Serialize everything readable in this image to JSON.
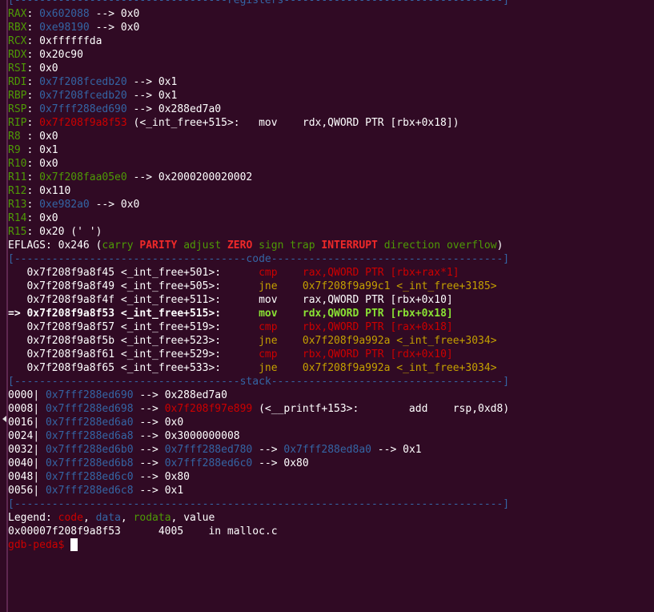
{
  "registers_header": "[----------------------------------registers-----------------------------------]",
  "registers": [
    {
      "name": "RAX",
      "addr": "0x602088",
      "deref": " --> 0x0",
      "addr_color": "blue"
    },
    {
      "name": "RBX",
      "addr": "0xe98190",
      "deref": " --> 0x0",
      "addr_color": "blue"
    },
    {
      "name": "RCX",
      "addr": "0xffffffda",
      "deref": "",
      "addr_color": "white"
    },
    {
      "name": "RDX",
      "addr": "0x20c90",
      "deref": "",
      "addr_color": "white"
    },
    {
      "name": "RSI",
      "addr": "0x0",
      "deref": "",
      "addr_color": "white"
    },
    {
      "name": "RDI",
      "addr": "0x7f208fcedb20",
      "deref": " --> 0x1",
      "addr_color": "blue"
    },
    {
      "name": "RBP",
      "addr": "0x7f208fcedb20",
      "deref": " --> 0x1",
      "addr_color": "blue"
    },
    {
      "name": "RSP",
      "addr": "0x7fff288ed690",
      "deref": " --> 0x288ed7a0",
      "addr_color": "blue"
    },
    {
      "name": "RIP",
      "addr": "0x7f208f9a8f53",
      "deref": " (<_int_free+515>:   mov    rdx,QWORD PTR [rbx+0x18])",
      "addr_color": "red"
    },
    {
      "name": "R8 ",
      "addr": "0x0",
      "deref": "",
      "addr_color": "white"
    },
    {
      "name": "R9 ",
      "addr": "0x1",
      "deref": "",
      "addr_color": "white"
    },
    {
      "name": "R10",
      "addr": "0x0",
      "deref": "",
      "addr_color": "white"
    },
    {
      "name": "R11",
      "addr": "0x7f208faa05e0",
      "deref": " --> 0x2000200020002",
      "addr_color": "green"
    },
    {
      "name": "R12",
      "addr": "0x110",
      "deref": "",
      "addr_color": "white"
    },
    {
      "name": "R13",
      "addr": "0xe982a0",
      "deref": " --> 0x0",
      "addr_color": "blue"
    },
    {
      "name": "R14",
      "addr": "0x0",
      "deref": "",
      "addr_color": "white"
    },
    {
      "name": "R15",
      "addr": "0x20 (' ')",
      "deref": "",
      "addr_color": "white"
    }
  ],
  "eflags": {
    "label": "EFLAGS",
    "value": "0x246",
    "flags": [
      {
        "text": "carry",
        "on": false
      },
      {
        "text": "PARITY",
        "on": true
      },
      {
        "text": "adjust",
        "on": false
      },
      {
        "text": "ZERO",
        "on": true
      },
      {
        "text": "sign",
        "on": false
      },
      {
        "text": "trap",
        "on": false
      },
      {
        "text": "INTERRUPT",
        "on": true
      },
      {
        "text": "direction",
        "on": false
      },
      {
        "text": "overflow",
        "on": false
      }
    ]
  },
  "code_header": "[-------------------------------------code-------------------------------------]",
  "code": [
    {
      "prefix": "   ",
      "addr": "0x7f208f9a8f45",
      "sym": "<_int_free+501>:",
      "mnem": "cmp",
      "ops": "rax,QWORD PTR [rbx+rax*1]",
      "color": "red",
      "current": false
    },
    {
      "prefix": "   ",
      "addr": "0x7f208f9a8f49",
      "sym": "<_int_free+505>:",
      "mnem": "jne",
      "ops": "0x7f208f9a99c1 <_int_free+3185>",
      "color": "yellow",
      "current": false
    },
    {
      "prefix": "   ",
      "addr": "0x7f208f9a8f4f",
      "sym": "<_int_free+511>:",
      "mnem": "mov",
      "ops": "rax,QWORD PTR [rbx+0x10]",
      "color": "white",
      "current": false
    },
    {
      "prefix": "=> ",
      "addr": "0x7f208f9a8f53",
      "sym": "<_int_free+515>:",
      "mnem": "mov",
      "ops": "rdx,QWORD PTR [rbx+0x18]",
      "color": "bgreen",
      "current": true
    },
    {
      "prefix": "   ",
      "addr": "0x7f208f9a8f57",
      "sym": "<_int_free+519>:",
      "mnem": "cmp",
      "ops": "rbx,QWORD PTR [rax+0x18]",
      "color": "red",
      "current": false
    },
    {
      "prefix": "   ",
      "addr": "0x7f208f9a8f5b",
      "sym": "<_int_free+523>:",
      "mnem": "jne",
      "ops": "0x7f208f9a992a <_int_free+3034>",
      "color": "yellow",
      "current": false
    },
    {
      "prefix": "   ",
      "addr": "0x7f208f9a8f61",
      "sym": "<_int_free+529>:",
      "mnem": "cmp",
      "ops": "rbx,QWORD PTR [rdx+0x10]",
      "color": "red",
      "current": false
    },
    {
      "prefix": "   ",
      "addr": "0x7f208f9a8f65",
      "sym": "<_int_free+533>:",
      "mnem": "jne",
      "ops": "0x7f208f9a992a <_int_free+3034>",
      "color": "yellow",
      "current": false
    }
  ],
  "stack_header": "[------------------------------------stack-------------------------------------]",
  "stack": [
    {
      "off": "0000",
      "addr": "0x7fff288ed690",
      "rest": [
        {
          "t": " --> ",
          "c": "white"
        },
        {
          "t": "0x288ed7a0",
          "c": "white"
        }
      ]
    },
    {
      "off": "0008",
      "addr": "0x7fff288ed698",
      "rest": [
        {
          "t": " --> ",
          "c": "white"
        },
        {
          "t": "0x7f208f97e899",
          "c": "red"
        },
        {
          "t": " (<__printf+153>:        add    rsp,0xd8)",
          "c": "white"
        }
      ]
    },
    {
      "off": "0016",
      "addr": "0x7fff288ed6a0",
      "rest": [
        {
          "t": " --> ",
          "c": "white"
        },
        {
          "t": "0x0",
          "c": "white"
        }
      ]
    },
    {
      "off": "0024",
      "addr": "0x7fff288ed6a8",
      "rest": [
        {
          "t": " --> ",
          "c": "white"
        },
        {
          "t": "0x3000000008",
          "c": "white"
        }
      ]
    },
    {
      "off": "0032",
      "addr": "0x7fff288ed6b0",
      "rest": [
        {
          "t": " --> ",
          "c": "white"
        },
        {
          "t": "0x7fff288ed780",
          "c": "blue"
        },
        {
          "t": " --> ",
          "c": "white"
        },
        {
          "t": "0x7fff288ed8a0",
          "c": "blue"
        },
        {
          "t": " --> ",
          "c": "white"
        },
        {
          "t": "0x1",
          "c": "white"
        }
      ]
    },
    {
      "off": "0040",
      "addr": "0x7fff288ed6b8",
      "rest": [
        {
          "t": " --> ",
          "c": "white"
        },
        {
          "t": "0x7fff288ed6c0",
          "c": "blue"
        },
        {
          "t": " --> ",
          "c": "white"
        },
        {
          "t": "0x80",
          "c": "white"
        }
      ]
    },
    {
      "off": "0048",
      "addr": "0x7fff288ed6c0",
      "rest": [
        {
          "t": " --> ",
          "c": "white"
        },
        {
          "t": "0x80",
          "c": "white"
        }
      ]
    },
    {
      "off": "0056",
      "addr": "0x7fff288ed6c8",
      "rest": [
        {
          "t": " --> ",
          "c": "white"
        },
        {
          "t": "0x1",
          "c": "white"
        }
      ]
    }
  ],
  "footer_rule": "[------------------------------------------------------------------------------]",
  "legend": {
    "label": "Legend: ",
    "items": [
      {
        "text": "code",
        "color": "red"
      },
      {
        "text": "data",
        "color": "blue"
      },
      {
        "text": "rodata",
        "color": "green"
      },
      {
        "text": "value",
        "color": "white"
      }
    ]
  },
  "location": "0x00007f208f9a8f53      4005    in malloc.c",
  "prompt": "gdb-peda$ ",
  "colors": {
    "background": "#300a24",
    "blue": "#3465a4",
    "green": "#4e9a06",
    "red": "#cc0000",
    "yellow": "#c4a000"
  }
}
